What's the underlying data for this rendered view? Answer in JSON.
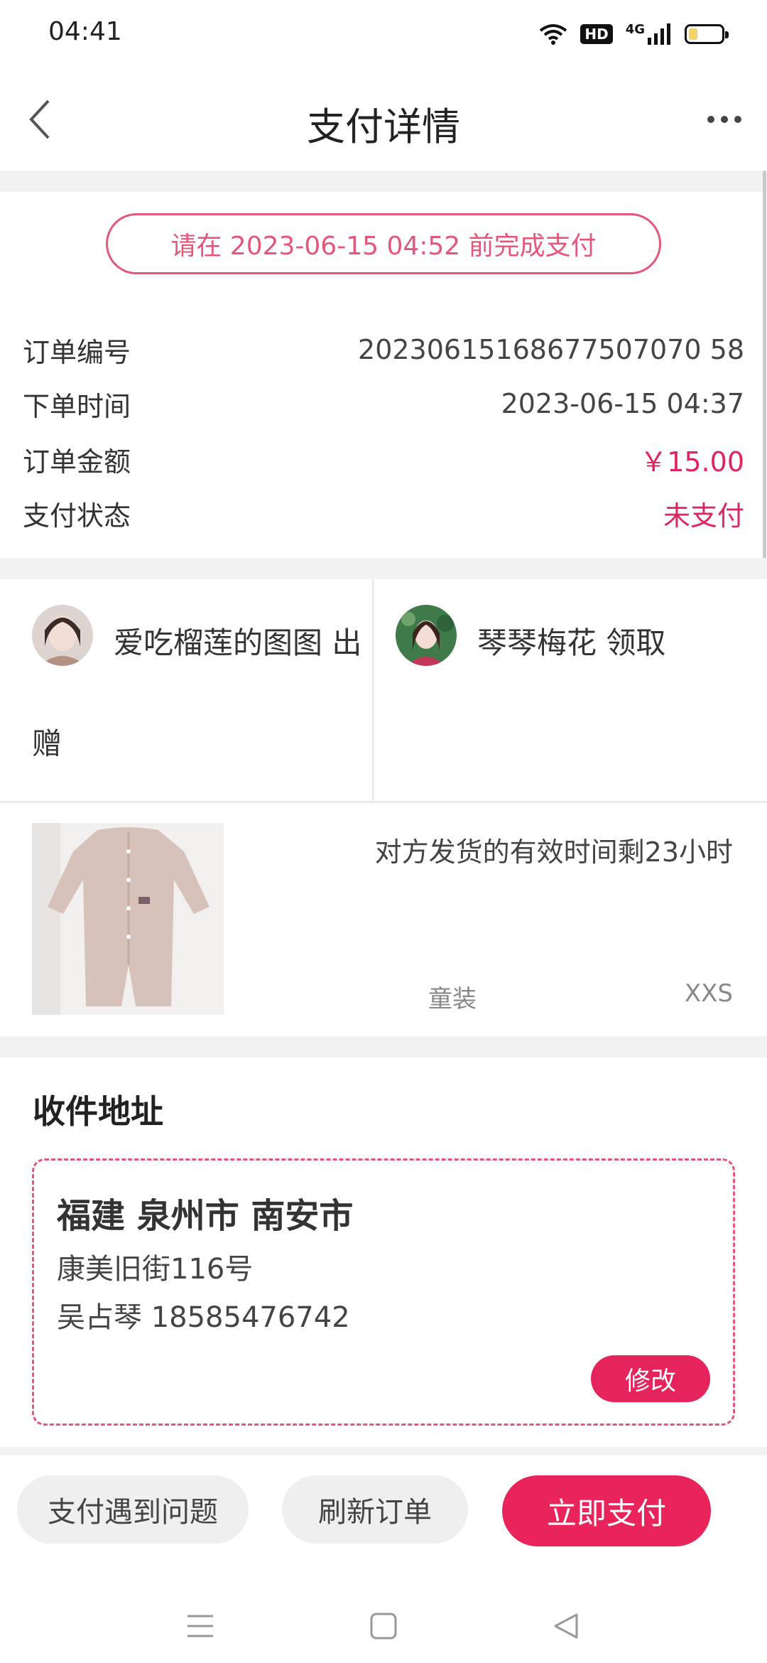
{
  "status_bar": {
    "time": "04:41",
    "hd": "HD",
    "network": "4G",
    "icons": [
      "wifi-icon",
      "hd-icon",
      "signal-icon",
      "battery-icon"
    ]
  },
  "nav": {
    "title": "支付详情",
    "icons": [
      "back-arrow-icon",
      "more-icon"
    ]
  },
  "deadline": "请在 2023-06-15 04:52 前完成支付",
  "order_info": [
    {
      "label": "订单编号",
      "value": "20230615168677507070 58"
    },
    {
      "label": "下单时间",
      "value": "2023-06-15 04:37"
    },
    {
      "label": "订单金额",
      "value": "￥15.00"
    },
    {
      "label": "支付状态",
      "value": "未支付"
    }
  ],
  "giver": {
    "text_line1": "爱吃榴莲的图图 出",
    "text_line2": "赠"
  },
  "receiver": {
    "text": "琴琴梅花 领取"
  },
  "product": {
    "ship_notice": "对方发货的有效时间剩23小时",
    "category": "童装",
    "size": "XXS"
  },
  "address": {
    "section_title": "收件地址",
    "region": "福建 泉州市 南安市",
    "street": "康美旧街116号",
    "contact": "吴占琴 18585476742",
    "edit_label": "修改"
  },
  "actions": {
    "problem_label": "支付遇到问题",
    "refresh_label": "刷新订单",
    "pay_label": "立即支付"
  },
  "system_nav": {
    "icons": [
      "menu-icon",
      "home-icon",
      "back-icon"
    ]
  },
  "colors": {
    "accent": "#e4245a",
    "accent_outline": "#e4577a",
    "background_gap": "#f2f2f2",
    "battery_fill": "#f1d36b"
  }
}
